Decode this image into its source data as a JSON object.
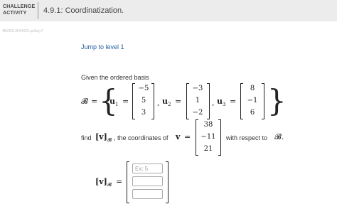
{
  "header": {
    "label_line1": "CHALLENGE",
    "label_line2": "ACTIVITY",
    "title": "4.9.1: Coordinatization."
  },
  "activity_id": "481550.3044322.qx3zqy7",
  "jump_link": "Jump to level 1",
  "problem": {
    "intro": "Given the ordered basis",
    "basis_symbol": "𝓑",
    "equals": "=",
    "left_brace": "{",
    "right_brace": "}",
    "vectors": [
      {
        "name": "u",
        "subscript": "1",
        "values": [
          "−5",
          "5",
          "3"
        ]
      },
      {
        "name": "u",
        "subscript": "2",
        "values": [
          "−3",
          "1",
          "−2"
        ]
      },
      {
        "name": "u",
        "subscript": "3",
        "values": [
          "8",
          "−1",
          "6"
        ]
      }
    ],
    "separator": ",",
    "find_text": "find",
    "coord_notation": "[v]",
    "coord_subscript": "𝓑",
    "middle_text": ", the coordinates of",
    "v_symbol": "v",
    "v_values": [
      "38",
      "−11",
      "21"
    ],
    "with_respect_text": "with respect to",
    "end_symbol": "𝓑."
  },
  "answer": {
    "placeholder": "Ex: 5",
    "values": [
      "",
      "",
      ""
    ]
  }
}
